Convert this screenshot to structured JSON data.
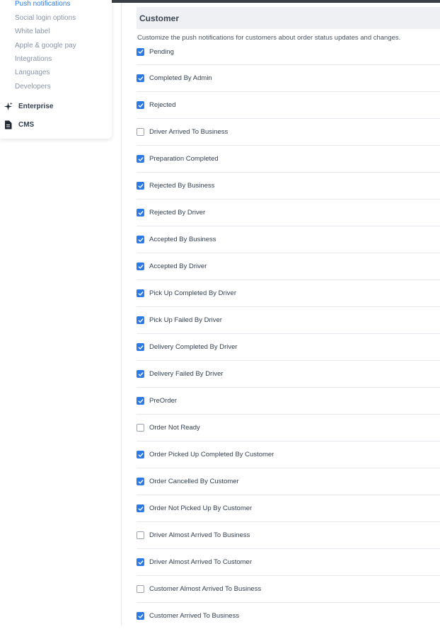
{
  "sidebar": {
    "sub_items": [
      {
        "label": "Push notifications",
        "active": true
      },
      {
        "label": "Social login options",
        "active": false
      },
      {
        "label": "White label",
        "active": false
      },
      {
        "label": "Apple & google pay",
        "active": false
      },
      {
        "label": "Integrations",
        "active": false
      },
      {
        "label": "Languages",
        "active": false
      },
      {
        "label": "Developers",
        "active": false
      }
    ],
    "main_items": [
      {
        "label": "Enterprise",
        "icon": "sparkles-icon"
      },
      {
        "label": "CMS",
        "icon": "document-icon"
      }
    ]
  },
  "section": {
    "title": "Customer",
    "description": "Customize the push notifications for customers about order status updates and changes."
  },
  "options": [
    {
      "label": "Pending",
      "checked": true
    },
    {
      "label": "Completed By Admin",
      "checked": true
    },
    {
      "label": "Rejected",
      "checked": true
    },
    {
      "label": "Driver Arrived To Business",
      "checked": false
    },
    {
      "label": "Preparation Completed",
      "checked": true
    },
    {
      "label": "Rejected By Business",
      "checked": true
    },
    {
      "label": "Rejected By Driver",
      "checked": true
    },
    {
      "label": "Accepted By Business",
      "checked": true
    },
    {
      "label": "Accepted By Driver",
      "checked": true
    },
    {
      "label": "Pick Up Completed By Driver",
      "checked": true
    },
    {
      "label": "Pick Up Failed By Driver",
      "checked": true
    },
    {
      "label": "Delivery Completed By Driver",
      "checked": true
    },
    {
      "label": "Delivery Failed By Driver",
      "checked": true
    },
    {
      "label": "PreOrder",
      "checked": true
    },
    {
      "label": "Order Not Ready",
      "checked": false
    },
    {
      "label": "Order Picked Up Completed By Customer",
      "checked": true
    },
    {
      "label": "Order Cancelled By Customer",
      "checked": true
    },
    {
      "label": "Order Not Picked Up By Customer",
      "checked": true
    },
    {
      "label": "Driver Almost Arrived To Business",
      "checked": false
    },
    {
      "label": "Driver Almost Arrived To Customer",
      "checked": true
    },
    {
      "label": "Customer Almost Arrived To Business",
      "checked": false
    },
    {
      "label": "Customer Arrived To Business",
      "checked": true
    }
  ],
  "colors": {
    "accent": "#2c7be5",
    "header_bg": "#eef0f3",
    "topbar": "#3a3f45"
  }
}
